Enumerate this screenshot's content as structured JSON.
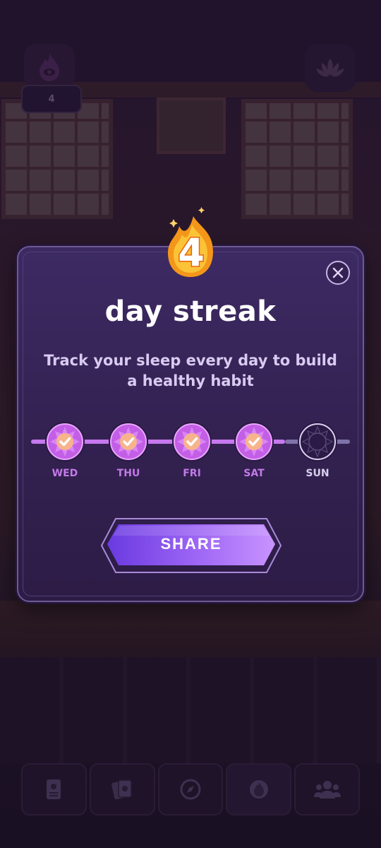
{
  "hud": {
    "streak_count": "4",
    "flame_icon": "flame-eye-icon",
    "lotus_icon": "lotus-icon"
  },
  "modal": {
    "badge_number": "4",
    "title": "day streak",
    "subtitle": "Track your sleep every day to build a healthy habit",
    "days": [
      {
        "label": "WED",
        "done": true
      },
      {
        "label": "THU",
        "done": true
      },
      {
        "label": "FRI",
        "done": true
      },
      {
        "label": "SAT",
        "done": true
      },
      {
        "label": "SUN",
        "done": false
      }
    ],
    "share_label": "SHARE"
  },
  "bottom_nav": {
    "items": [
      "journal-icon",
      "cards-icon",
      "compass-icon",
      "home-icon",
      "friends-icon"
    ],
    "active_index": 3
  },
  "colors": {
    "modal_bg": "#3d2a63",
    "accent_purple": "#c678ee",
    "flame_orange": "#f7a21b",
    "button_purple": "#8a5cf0"
  }
}
